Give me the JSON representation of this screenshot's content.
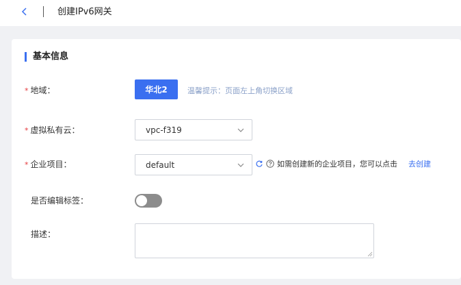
{
  "header": {
    "title": "创建IPv6网关"
  },
  "section": {
    "title": "基本信息"
  },
  "form": {
    "required_mark": "*",
    "region": {
      "label": "地域：",
      "button_label": "华北2",
      "hint": "温馨提示：页面左上角切换区域"
    },
    "vpc": {
      "label": "虚拟私有云：",
      "value": "vpc-f319"
    },
    "enterprise_project": {
      "label": "企业项目：",
      "value": "default",
      "tip": "如需创建新的企业项目，您可以点击",
      "tip_link": "去创建"
    },
    "edit_tags": {
      "label": "是否编辑标签：",
      "enabled": false
    },
    "description": {
      "label": "描述：",
      "value": ""
    }
  },
  "colors": {
    "accent": "#3a6ff0",
    "required": "#e4393c",
    "hint": "#8aa0c8",
    "toggle_off": "#8c8c8c"
  },
  "icons": {
    "back": "chevron-left-icon",
    "select_arrow": "chevron-down-icon",
    "refresh": "refresh-icon",
    "help": "help-icon"
  }
}
